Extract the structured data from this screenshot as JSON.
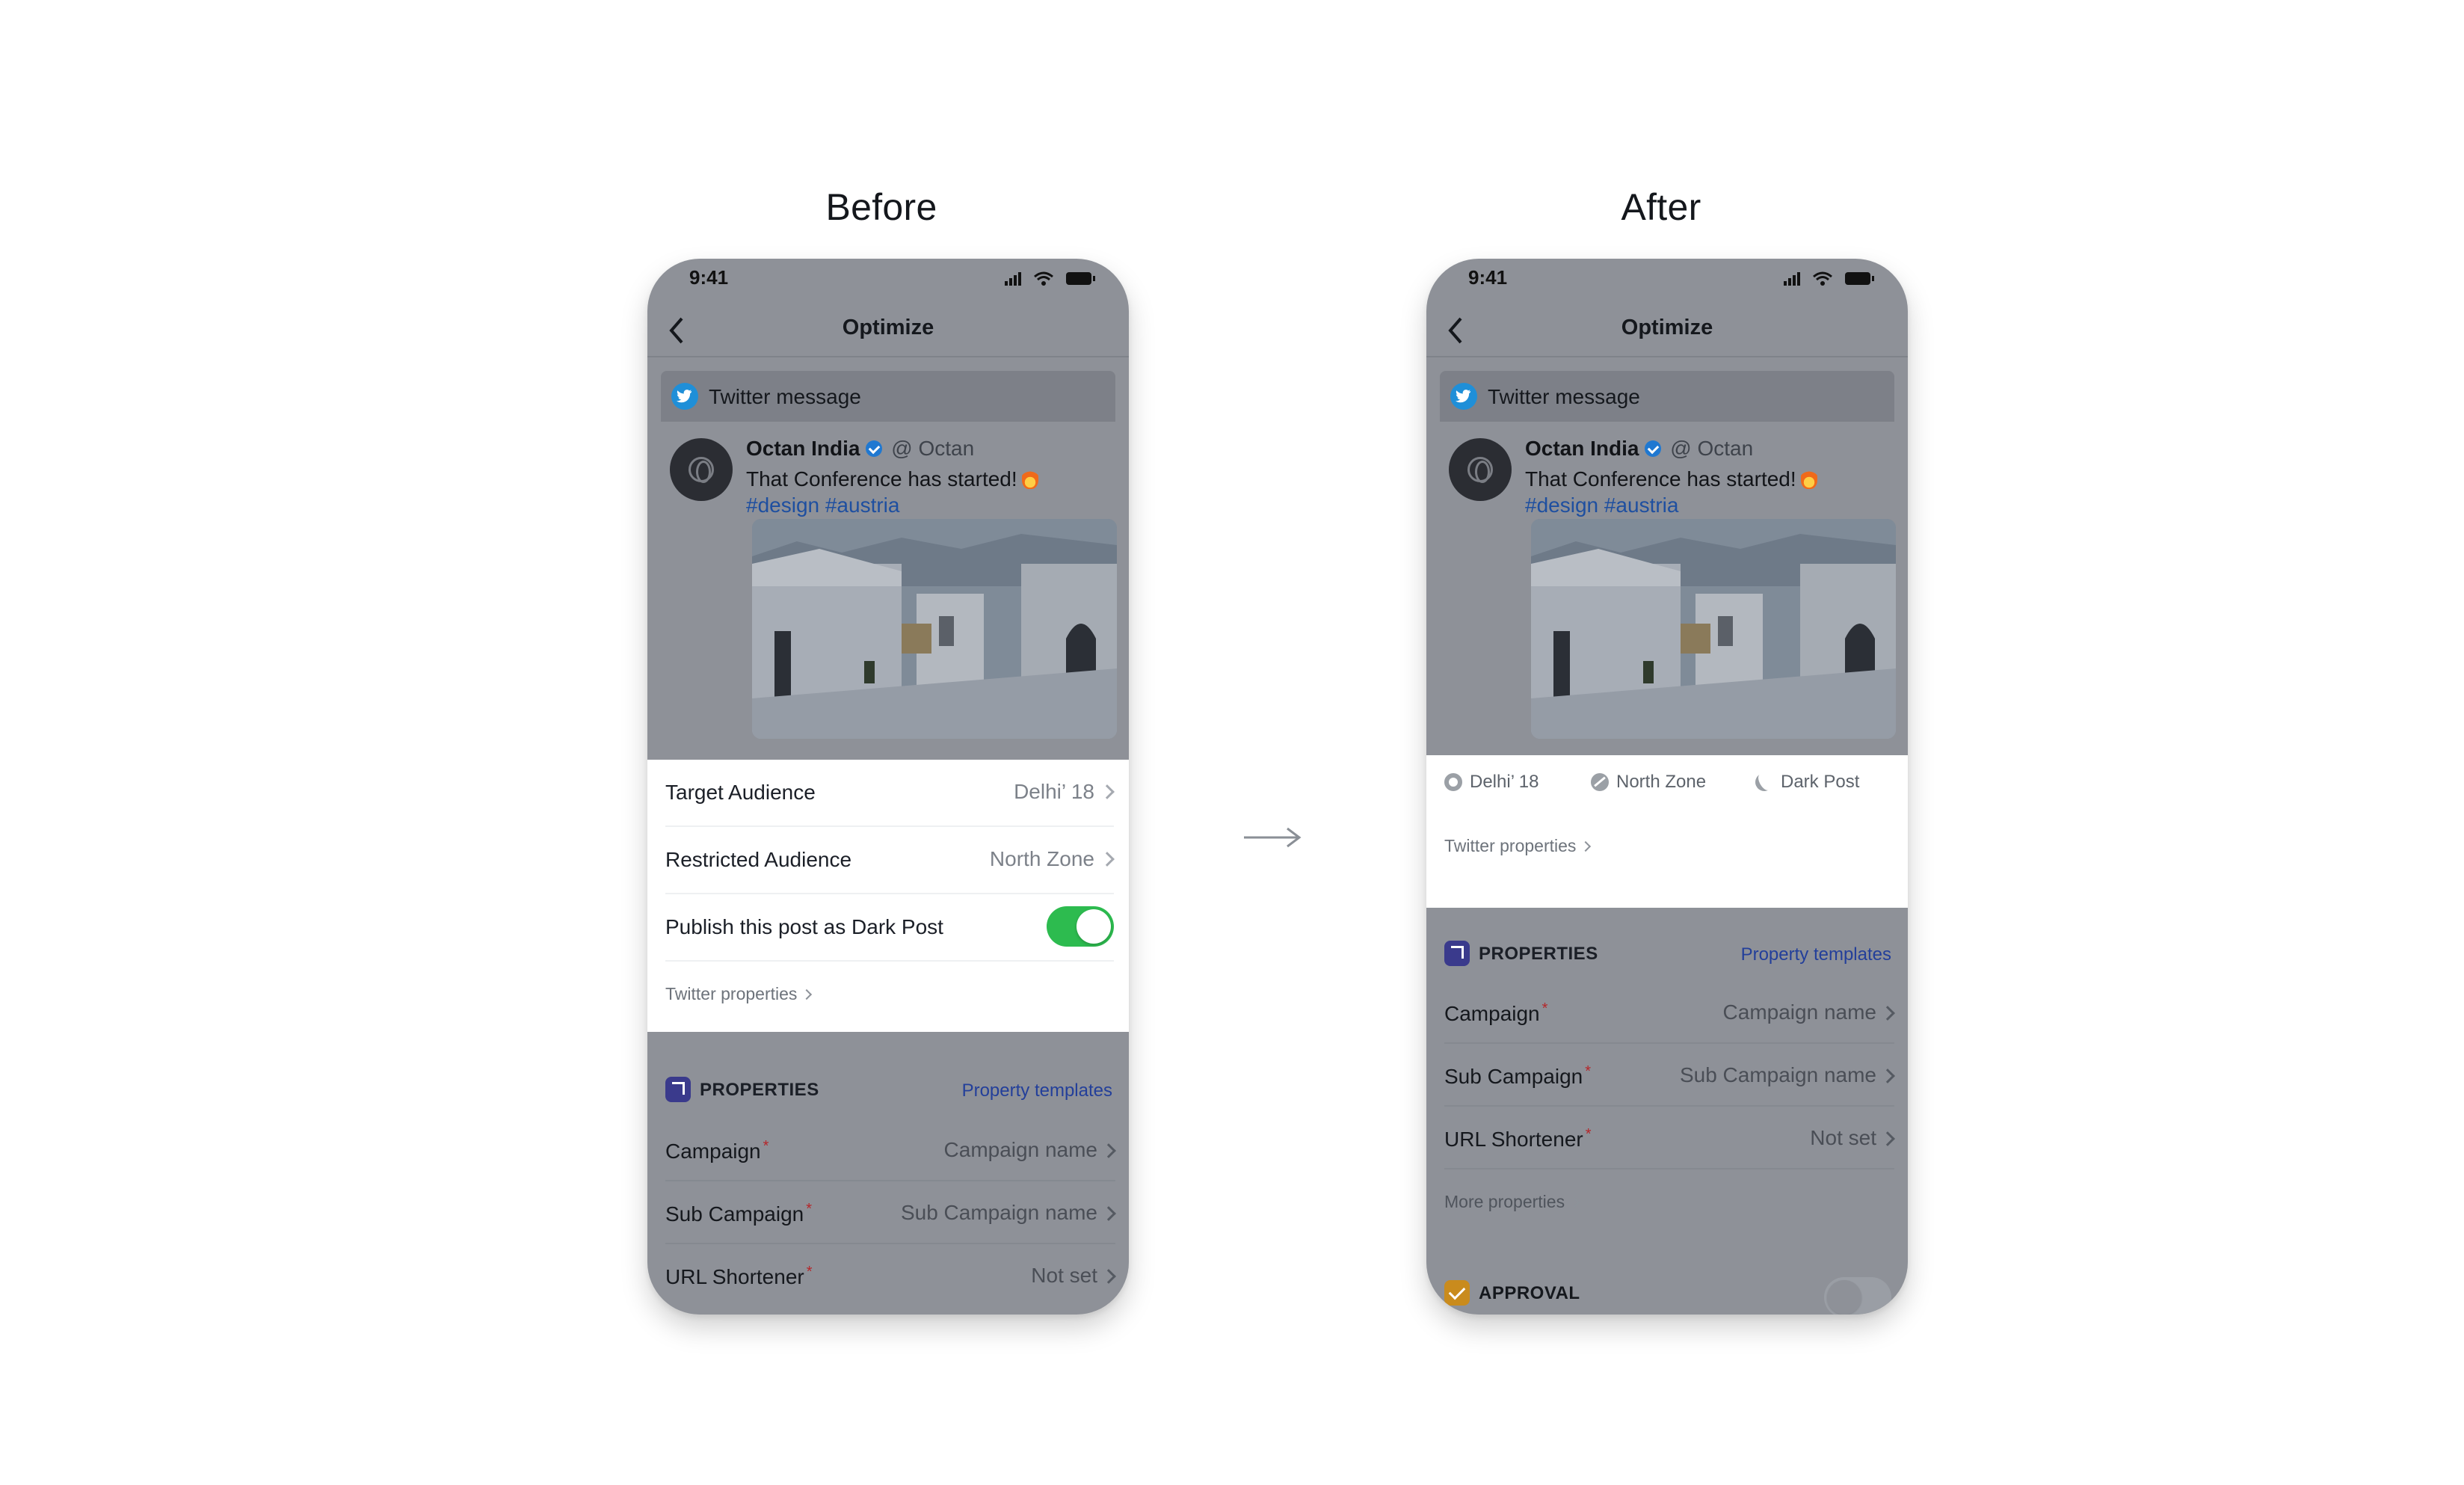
{
  "headings": {
    "before": "Before",
    "after": "After"
  },
  "phone": {
    "time": "9:41",
    "nav_title": "Optimize",
    "twitter": {
      "header_label": "Twitter message",
      "author": "Octan India",
      "handle": "@ Octan",
      "text": "That Conference has started!",
      "tags": "#design #austria"
    }
  },
  "before": {
    "rows": [
      {
        "label": "Target Audience",
        "value": "Delhi’ 18"
      },
      {
        "label": "Restricted Audience",
        "value": "North Zone"
      }
    ],
    "dark_post_label": "Publish this post as Dark Post",
    "dark_post_on": true,
    "twitter_properties": "Twitter properties"
  },
  "after": {
    "chips": [
      "Delhi’ 18",
      "North Zone",
      "Dark Post"
    ],
    "twitter_properties": "Twitter properties",
    "more_properties": "More properties",
    "approval_title": "APPROVAL",
    "approval_on": false
  },
  "properties": {
    "title": "PROPERTIES",
    "templates_link": "Property templates",
    "required_mark": "*",
    "rows": [
      {
        "label": "Campaign",
        "value": "Campaign name"
      },
      {
        "label": "Sub Campaign",
        "value": "Sub Campaign name"
      },
      {
        "label": "URL Shortener",
        "value": "Not set"
      }
    ]
  },
  "colors": {
    "overlay_grey": "#8e9198",
    "toggle_on": "#2dbb4f",
    "link_blue": "#233f9a",
    "twitter_blue": "#1f8fd8",
    "required_red": "#b5262a"
  }
}
